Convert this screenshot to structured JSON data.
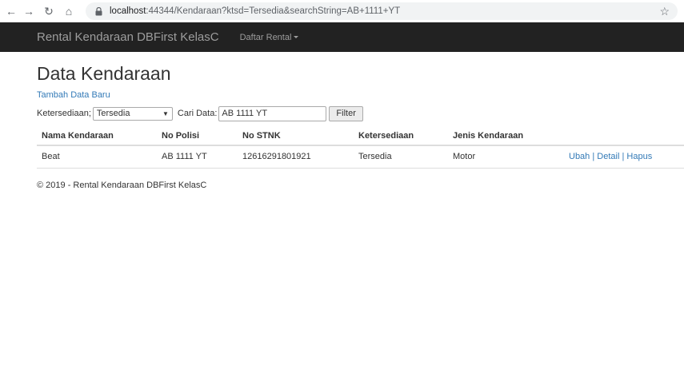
{
  "browser": {
    "url_host": "localhost",
    "url_rest": ":44344/Kendaraan?ktsd=Tersedia&searchString=AB+1111+YT"
  },
  "navbar": {
    "brand": "Rental Kendaraan DBFirst KelasC",
    "menu_label": "Daftar Rental"
  },
  "page": {
    "title": "Data Kendaraan",
    "create_link": "Tambah Data Baru"
  },
  "filter": {
    "ketersediaan_label": "Ketersediaan;",
    "ketersediaan_value": "Tersedia",
    "cari_label": "Cari Data:",
    "search_value": "AB 1111 YT",
    "button_label": "Filter"
  },
  "table": {
    "headers": [
      "Nama Kendaraan",
      "No Polisi",
      "No STNK",
      "Ketersediaan",
      "Jenis Kendaraan"
    ],
    "rows": [
      {
        "nama": "Beat",
        "polisi": "AB 1111 YT",
        "stnk": "12616291801921",
        "ketersediaan": "Tersedia",
        "jenis": "Motor",
        "actions": [
          "Ubah",
          "Detail",
          "Hapus"
        ]
      }
    ],
    "action_separator": "|"
  },
  "footer": {
    "text": "© 2019 - Rental Kendaraan DBFirst KelasC"
  }
}
